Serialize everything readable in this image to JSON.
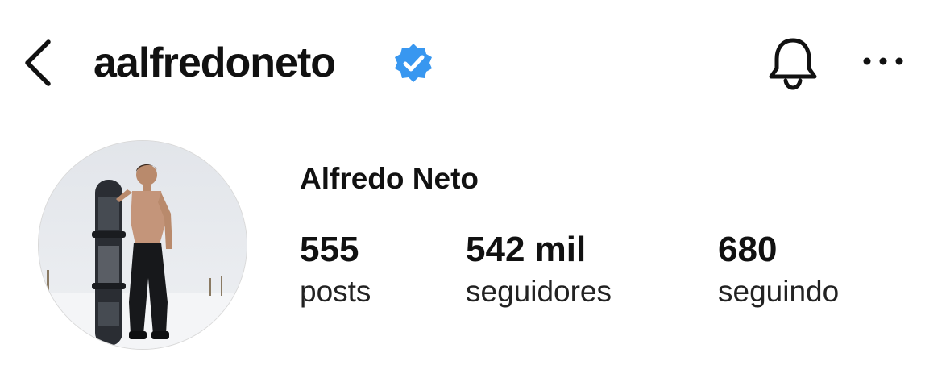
{
  "header": {
    "back_icon": "chevron-left-icon",
    "username": "aalfredoneto",
    "verified_icon": "verified-badge-icon",
    "verified_color": "#3897f0",
    "bell_icon": "bell-icon",
    "more_icon": "more-horizontal-icon"
  },
  "profile": {
    "avatar_alt": "profile picture",
    "display_name": "Alfredo Neto",
    "stats": {
      "posts": {
        "value": "555",
        "label": "posts"
      },
      "followers": {
        "value": "542 mil",
        "label": "seguidores"
      },
      "following": {
        "value": "680",
        "label": "seguindo"
      }
    }
  }
}
